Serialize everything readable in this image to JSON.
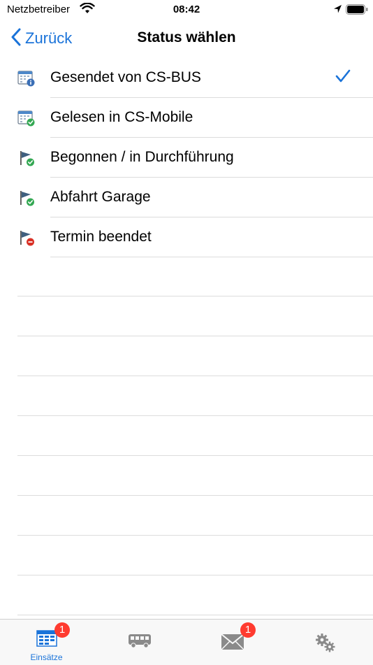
{
  "status_bar": {
    "carrier": "Netzbetreiber",
    "time": "08:42"
  },
  "nav": {
    "back_label": "Zurück",
    "title": "Status wählen"
  },
  "statuses": [
    {
      "label": "Gesendet von CS-BUS",
      "icon": "calendar-info-icon",
      "selected": true
    },
    {
      "label": "Gelesen in CS-Mobile",
      "icon": "calendar-check-icon",
      "selected": false
    },
    {
      "label": "Begonnen / in Durchführung",
      "icon": "flag-check-icon",
      "selected": false
    },
    {
      "label": "Abfahrt Garage",
      "icon": "flag-check-icon",
      "selected": false
    },
    {
      "label": "Termin beendet",
      "icon": "flag-stop-icon",
      "selected": false
    }
  ],
  "tabs": [
    {
      "label": "Einsätze",
      "icon": "schedule-grid-icon",
      "badge": "1",
      "active": true
    },
    {
      "label": "",
      "icon": "bus-icon",
      "badge": "",
      "active": false
    },
    {
      "label": "",
      "icon": "mail-icon",
      "badge": "1",
      "active": false
    },
    {
      "label": "",
      "icon": "gears-icon",
      "badge": "",
      "active": false
    }
  ],
  "colors": {
    "accent": "#1a73d9",
    "badge": "#ff3b30",
    "check_green": "#34a853",
    "stop_red": "#d93025",
    "info_blue": "#1a73d9"
  }
}
